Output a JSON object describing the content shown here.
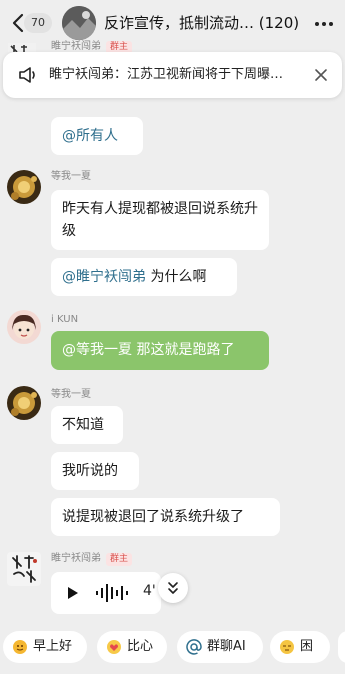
{
  "header": {
    "unread_count": "70",
    "title": "反诈宣传，抵制流动…  (120)"
  },
  "banner": {
    "text": "睢宁袄闯弟：江苏卫视新闻将于下周曝…"
  },
  "messages": [
    {
      "text": "@所有人"
    },
    {
      "sender": "等我一夏",
      "text": "昨天有人提现都被退回说系统升级"
    },
    {
      "mention": "@睢宁袄闯弟",
      "text": " 为什么啊"
    },
    {
      "sender": "i KUN",
      "mention": "@等我一夏",
      "text": " 那这就是跑路了"
    },
    {
      "sender": "等我一夏",
      "text": "不知道"
    },
    {
      "text": "我听说的"
    },
    {
      "text": "说提现被退回了说系统升级了"
    },
    {
      "sender": "睢宁袄闯弟",
      "badge": "群主",
      "voice_duration": "4'"
    }
  ],
  "top_partial": {
    "sender": "睢宁袄闯弟",
    "badge": "群主"
  },
  "quick_replies": [
    {
      "label": "早上好",
      "icon": "sun-face-emoji"
    },
    {
      "label": "比心",
      "icon": "heart-hands-emoji"
    },
    {
      "label": "群聊AI",
      "icon": "at-icon"
    },
    {
      "label": "困",
      "icon": "sleepy-face-emoji"
    }
  ],
  "colors": {
    "green_bubble": "#8bc56b",
    "mention": "#2f6f8d",
    "owner_badge": "#d9534f"
  }
}
